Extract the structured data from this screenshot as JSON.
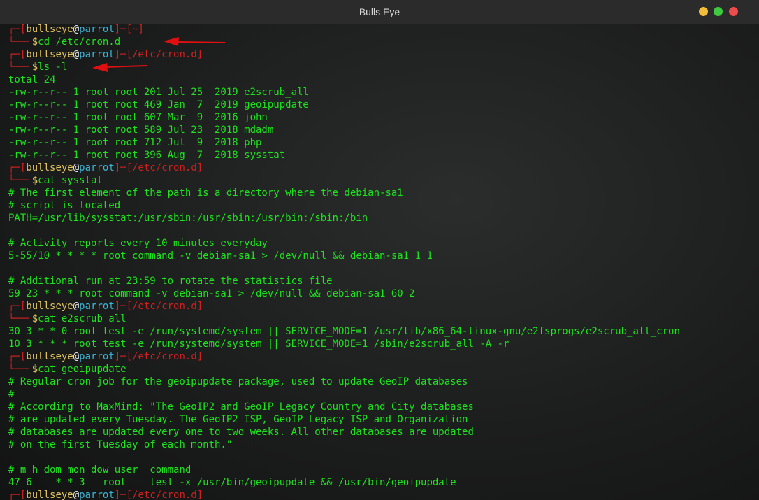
{
  "window": {
    "title": "Bulls Eye"
  },
  "prompt": {
    "user": "bullseye",
    "at": "@",
    "host": "parrot",
    "dollar": "$"
  },
  "lines": [
    {
      "t": "p1",
      "path": "~"
    },
    {
      "t": "p2",
      "cmd": "cd /etc/cron.d"
    },
    {
      "t": "p1",
      "path": "/etc/cron.d"
    },
    {
      "t": "p2",
      "cmd": "ls -l"
    },
    {
      "t": "o",
      "text": "total 24"
    },
    {
      "t": "o",
      "text": "-rw-r--r-- 1 root root 201 Jul 25  2019 e2scrub_all"
    },
    {
      "t": "o",
      "text": "-rw-r--r-- 1 root root 469 Jan  7  2019 geoipupdate"
    },
    {
      "t": "o",
      "text": "-rw-r--r-- 1 root root 607 Mar  9  2016 john"
    },
    {
      "t": "o",
      "text": "-rw-r--r-- 1 root root 589 Jul 23  2018 mdadm"
    },
    {
      "t": "o",
      "text": "-rw-r--r-- 1 root root 712 Jul  9  2018 php"
    },
    {
      "t": "o",
      "text": "-rw-r--r-- 1 root root 396 Aug  7  2018 sysstat"
    },
    {
      "t": "p1",
      "path": "/etc/cron.d"
    },
    {
      "t": "p2",
      "cmd": "cat sysstat"
    },
    {
      "t": "o",
      "text": "# The first element of the path is a directory where the debian-sa1"
    },
    {
      "t": "o",
      "text": "# script is located"
    },
    {
      "t": "o",
      "text": "PATH=/usr/lib/sysstat:/usr/sbin:/usr/sbin:/usr/bin:/sbin:/bin"
    },
    {
      "t": "o",
      "text": ""
    },
    {
      "t": "o",
      "text": "# Activity reports every 10 minutes everyday"
    },
    {
      "t": "o",
      "text": "5-55/10 * * * * root command -v debian-sa1 > /dev/null && debian-sa1 1 1"
    },
    {
      "t": "o",
      "text": ""
    },
    {
      "t": "o",
      "text": "# Additional run at 23:59 to rotate the statistics file"
    },
    {
      "t": "o",
      "text": "59 23 * * * root command -v debian-sa1 > /dev/null && debian-sa1 60 2"
    },
    {
      "t": "p1",
      "path": "/etc/cron.d"
    },
    {
      "t": "p2",
      "cmd": "cat e2scrub_all"
    },
    {
      "t": "o",
      "text": "30 3 * * 0 root test -e /run/systemd/system || SERVICE_MODE=1 /usr/lib/x86_64-linux-gnu/e2fsprogs/e2scrub_all_cron"
    },
    {
      "t": "o",
      "text": "10 3 * * * root test -e /run/systemd/system || SERVICE_MODE=1 /sbin/e2scrub_all -A -r"
    },
    {
      "t": "p1",
      "path": "/etc/cron.d"
    },
    {
      "t": "p2",
      "cmd": "cat geoipupdate"
    },
    {
      "t": "o",
      "text": "# Regular cron job for the geoipupdate package, used to update GeoIP databases"
    },
    {
      "t": "o",
      "text": "#"
    },
    {
      "t": "o",
      "text": "# According to MaxMind: \"The GeoIP2 and GeoIP Legacy Country and City databases"
    },
    {
      "t": "o",
      "text": "# are updated every Tuesday. The GeoIP2 ISP, GeoIP Legacy ISP and Organization"
    },
    {
      "t": "o",
      "text": "# databases are updated every one to two weeks. All other databases are updated"
    },
    {
      "t": "o",
      "text": "# on the first Tuesday of each month.\""
    },
    {
      "t": "o",
      "text": ""
    },
    {
      "t": "o",
      "text": "# m h dom mon dow user  command"
    },
    {
      "t": "o",
      "text": "47 6    * * 3   root    test -x /usr/bin/geoipupdate && /usr/bin/geoipupdate"
    },
    {
      "t": "p1",
      "path": "/etc/cron.d"
    }
  ],
  "colors": {
    "prompt_frame": "#d02020",
    "user": "#e0c25e",
    "host": "#39b5d8",
    "output": "#1ee21e",
    "arrow": "#e01010"
  },
  "annotations": [
    {
      "name": "red-arrow-cd",
      "points_to": "cd /etc/cron.d"
    },
    {
      "name": "red-arrow-ls",
      "points_to": "ls -l"
    }
  ]
}
